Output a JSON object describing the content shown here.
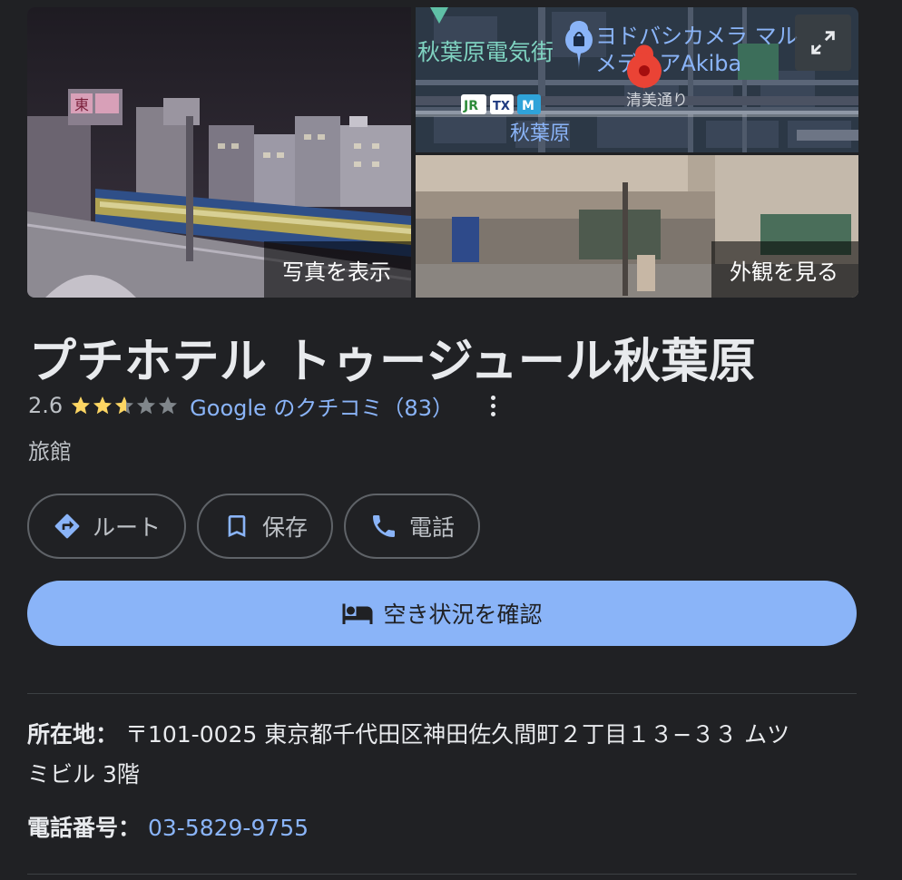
{
  "photos": {
    "photos_label": "写真を表示",
    "street_view_label": "外観を見る",
    "map": {
      "area_label": "秋葉原電気街",
      "store_label_line1": "ヨドバシカメラ マル",
      "store_label_line2": "メディアAkiba",
      "street_label": "清美通り",
      "station_label": "秋葉原",
      "rail_badges": [
        "JR",
        "TX",
        "M"
      ]
    },
    "photo_sign_text": "東"
  },
  "place": {
    "name": "プチホテル トゥージュール秋葉原",
    "rating": "2.6",
    "rating_stars": 2.6,
    "reviews_text": "Google のクチコミ（83）",
    "category": "旅館"
  },
  "actions": {
    "route_label": "ルート",
    "save_label": "保存",
    "call_label": "電話",
    "check_availability_label": "空き状況を確認"
  },
  "info": {
    "address_label": "所在地：",
    "address_line1": "〒101-0025 東京都千代田区神田佐久間町２丁目１３−３３ ムツ",
    "address_line2": "ミビル 3階",
    "phone_label": "電話番号：",
    "phone_value": "03-5829-9755"
  },
  "colors": {
    "background": "#202124",
    "link": "#8ab4f8",
    "star": "#fdd663",
    "star_empty": "#80868b",
    "primary_button": "#8ab4f8",
    "map_pin": "#ea4335"
  }
}
